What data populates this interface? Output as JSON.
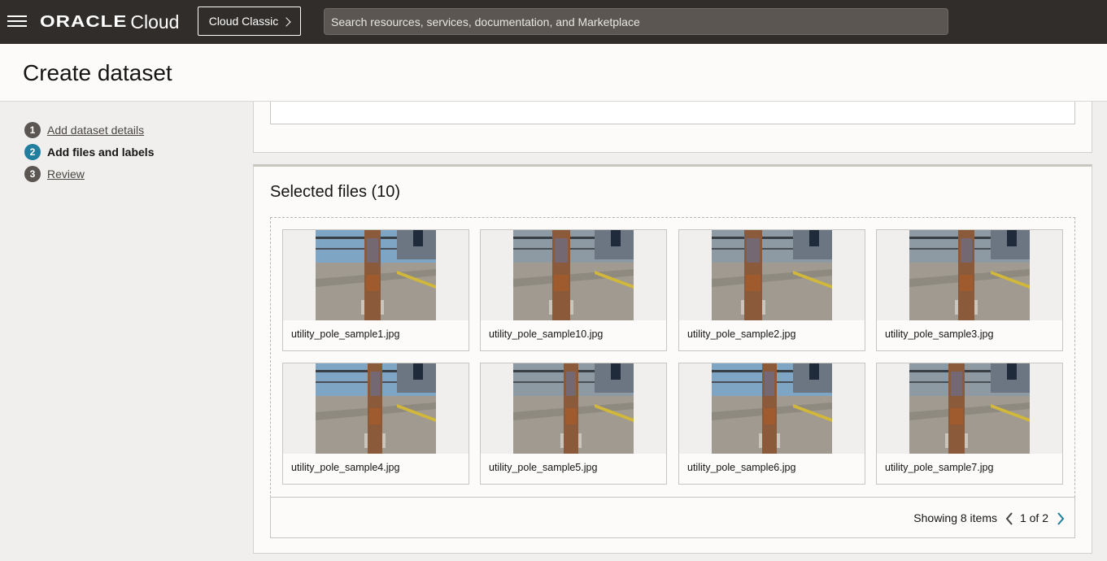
{
  "topbar": {
    "brand_oracle": "ORACLE",
    "brand_cloud": "Cloud",
    "classic_label": "Cloud Classic",
    "search_placeholder": "Search resources, services, documentation, and Marketplace"
  },
  "page": {
    "title": "Create dataset"
  },
  "steps": [
    {
      "num": "1",
      "label": "Add dataset details",
      "active": false
    },
    {
      "num": "2",
      "label": "Add files and labels",
      "active": true
    },
    {
      "num": "3",
      "label": "Review",
      "active": false
    }
  ],
  "selected": {
    "title": "Selected files (10)",
    "files": [
      "utility_pole_sample1.jpg",
      "utility_pole_sample10.jpg",
      "utility_pole_sample2.jpg",
      "utility_pole_sample3.jpg",
      "utility_pole_sample4.jpg",
      "utility_pole_sample5.jpg",
      "utility_pole_sample6.jpg",
      "utility_pole_sample7.jpg"
    ],
    "showing": "Showing 8 items",
    "page_indicator": "1 of 2"
  },
  "colors": {
    "topbar": "#312d2a",
    "active_step": "#227e9e",
    "link_arrow": "#227e9e"
  }
}
